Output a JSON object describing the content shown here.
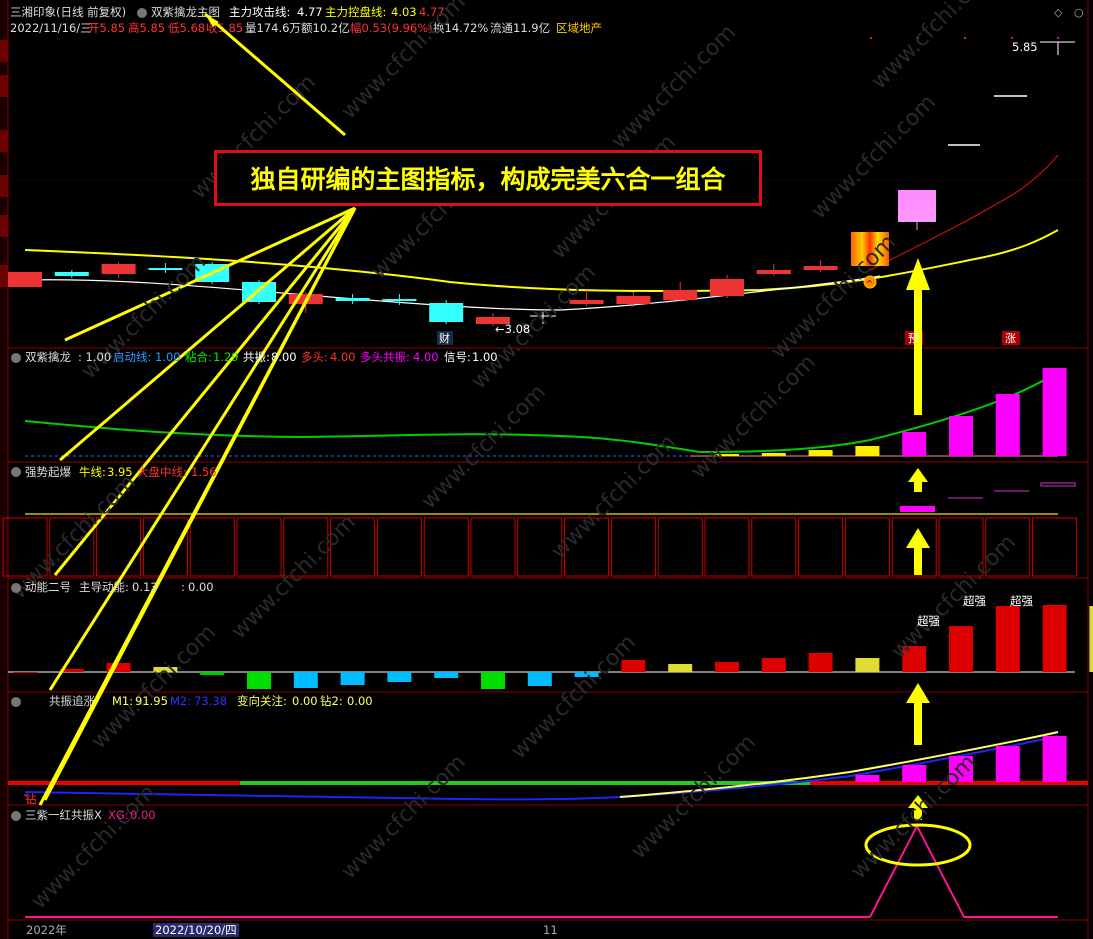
{
  "main_header": {
    "stock": "三湘印象(日线 前复权)",
    "indicator": "双紫擒龙主图",
    "attack_label": "主力攻击线:",
    "attack_value": "4.77",
    "control_label": "主力控盘线:",
    "control_value": "4.03",
    "extra_value": "4.77"
  },
  "quote": {
    "date": "2022/11/16/三",
    "open": "开5.85",
    "high": "高5.85",
    "low": "低5.68",
    "close": "收5.85",
    "volume": "量174.6万",
    "amount": "额10.2亿",
    "change": "幅0.53(9.96%)",
    "turnover": "换14.72%",
    "float": "流通11.9亿",
    "sector": "区域地产"
  },
  "price_labels": {
    "high": "5.85",
    "low": "←3.08",
    "cai": "财",
    "zhang": "涨",
    "yi": "预"
  },
  "callout": "独自研编的主图指标，构成完美六合一组合",
  "panel1": {
    "name": "双紫擒龙",
    "v": ": 1.00",
    "l1": "启动线:",
    "v1": "1.00",
    "l2": "粘合:",
    "v2": "1.29",
    "l3": "共振:",
    "v3": "8.00",
    "l4": "多头:",
    "v4": "4.00",
    "l5": "多头共振:",
    "v5": "4.00",
    "l6": "信号:",
    "v6": "1.00"
  },
  "panel2": {
    "name": "强势起爆",
    "l1": "牛线:",
    "v1": "3.95",
    "l2": "大盘中线:",
    "v2": "1.56"
  },
  "panel3": {
    "name": "动能二号",
    "l1": "主导动能:",
    "v1": "0.13",
    "l2": ":",
    "v2": "0.00",
    "tag1": "超强",
    "tag2": "超强",
    "tag3": "超强"
  },
  "panel4": {
    "name": "共振追涨",
    "l1": "M1:",
    "v1": "91.95",
    "l2": "M2:",
    "v2": "73.38",
    "l3": "变向关注:",
    "v3": "0.00",
    "l4": "钻2:",
    "v4": "0.00",
    "zuan": "钻"
  },
  "panel5": {
    "name": "三紫一红共振X",
    "l1": "XG:",
    "v1": "0.00"
  },
  "xaxis": {
    "year": "2022年",
    "date": "2022/10/20/四",
    "month": "11"
  },
  "watermark": "www.cfchi.com",
  "colors": {
    "up": "#ff3333",
    "down": "#33ffff",
    "yellow": "#ffff00",
    "magenta": "#ff00ff",
    "green": "#00ee00",
    "border": "#8b0000"
  }
}
